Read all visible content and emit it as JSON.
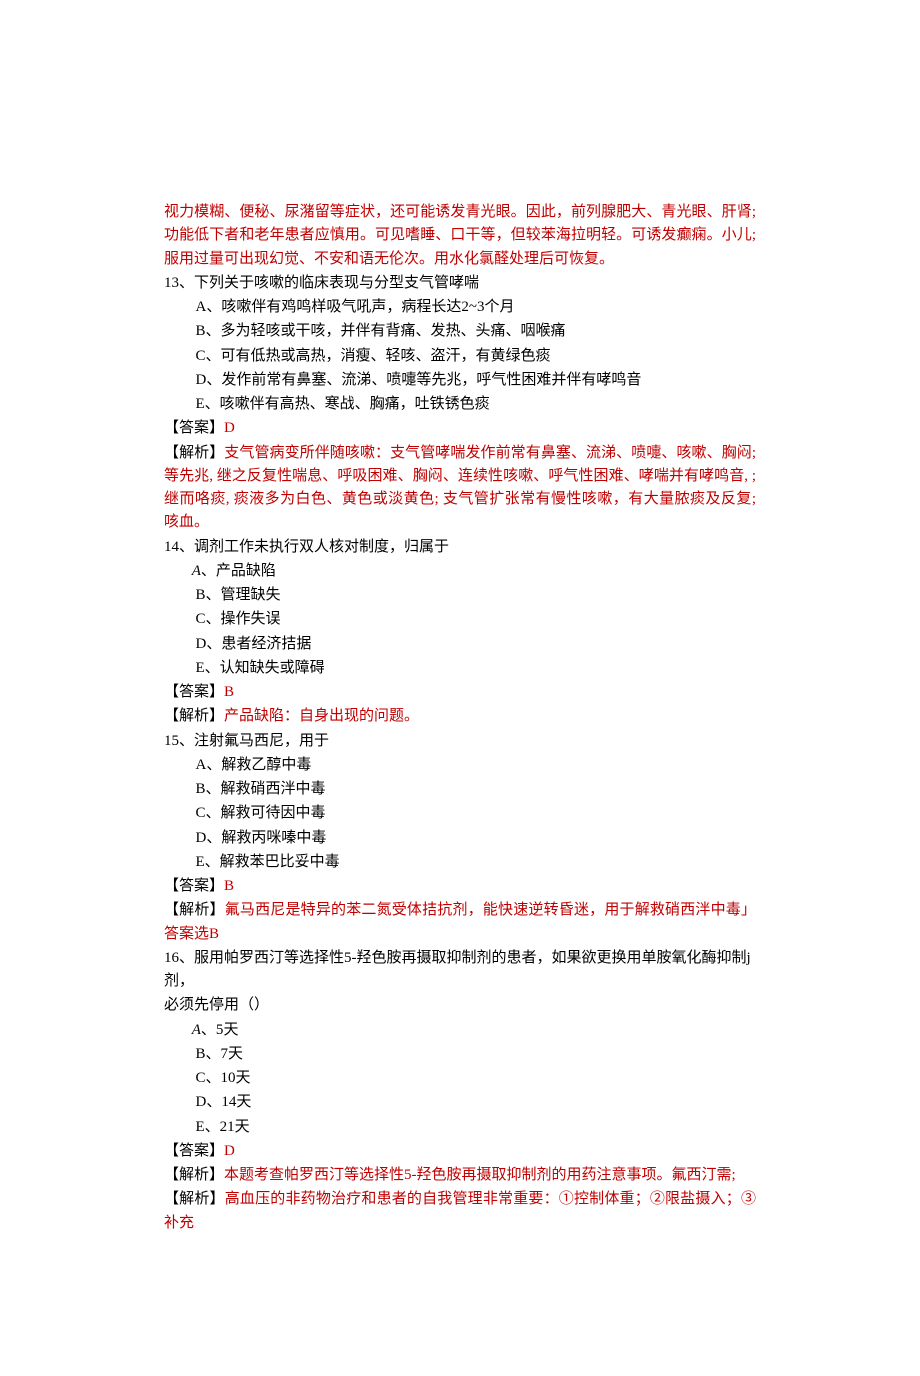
{
  "intro_explanation": "视力模糊、便秘、尿潴留等症状，还可能诱发青光眼。因此，前列腺肥大、青光眼、肝肾; 功能低下者和老年患者应慎用。可见嗜睡、口干等，但较苯海拉明轻。可诱发癫痫。小儿; 服用过量可出现幻觉、不安和语无伦次。用水化氯醛处理后可恢复。",
  "q13": {
    "stem": "13、下列关于咳嗽的临床表现与分型支气管哮喘",
    "options": {
      "A": "A、咳嗽伴有鸡鸣样吸气吼声，病程长达2~3个月",
      "B": "B、多为轻咳或干咳，并伴有背痛、发热、头痛、咽喉痛",
      "C": "C、可有低热或高热，消瘦、轻咳、盗汗，有黄绿色痰",
      "D": "D、发作前常有鼻塞、流涕、喷嚏等先兆，呼气性困难并伴有哮鸣音",
      "E": "E、咳嗽伴有高热、寒战、胸痛，吐铁锈色痰"
    },
    "answer_label": "【答案】",
    "answer_value": "D",
    "explanation_label": "【解析】",
    "explanation": "支气管病变所伴随咳嗽：支气管哮喘发作前常有鼻塞、流涕、喷嚏、咳嗽、胸闷;等先兆, 继之反复性喘息、呼吸困难、胸闷、连续性咳嗽、呼气性困难、哮喘并有哮鸣音, ; 继而咯痰, 痰液多为白色、黄色或淡黄色; 支气管扩张常有慢性咳嗽，有大量脓痰及反复; 咳血。"
  },
  "q14": {
    "stem": "14、调剂工作未执行双人核对制度，归属于",
    "options": {
      "A": "A、产品缺陷",
      "B": "B、管理缺失",
      "C": "C、操作失误",
      "D": "D、患者经济拮据",
      "E": "E、认知缺失或障碍"
    },
    "answer_label": "【答案】",
    "answer_value": "B",
    "explanation_label": "【解析】",
    "explanation": "产品缺陷：自身出现的问题。"
  },
  "q15": {
    "stem": "15、注射氟马西尼，用于",
    "options": {
      "A": "A、解救乙醇中毒",
      "B": "B、解救硝西泮中毒",
      "C": "C、解救可待因中毒",
      "D": "D、解救丙咪嗪中毒",
      "E": "E、解救苯巴比妥中毒"
    },
    "answer_label": "【答案】",
    "answer_value": "B",
    "explanation_label": "【解析】",
    "explanation": "氟马西尼是特异的苯二氮受体拮抗剂，能快速逆转昏迷，用于解救硝西泮中毒」答案选B"
  },
  "q16": {
    "stem_part1": "16、服用帕罗西汀等选择性5-羟色胺再摄取抑制剂的患者，如果欲更换用单胺氧化酶抑制j剂，",
    "stem_part2": "必须先停用（）",
    "options": {
      "A": "A、5天",
      "B": "B、7天",
      "C": "C、10天",
      "D": "D、14天",
      "E": "E、21天"
    },
    "answer_label": "【答案】",
    "answer_value": "D",
    "explanation_label": "【解析】",
    "explanation1": "本题考查帕罗西汀等选择性5-羟色胺再摄取抑制剂的用药注意事项。氟西汀需;",
    "explanation2": "高血压的非药物治疗和患者的自我管理非常重要：①控制体重；②限盐摄入；③补充"
  }
}
